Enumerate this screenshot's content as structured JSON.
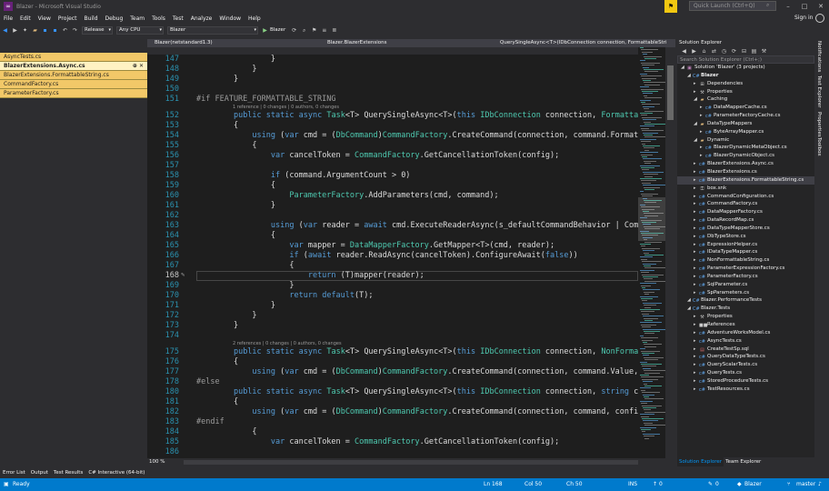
{
  "window": {
    "title": "Blazer - Microsoft Visual Studio",
    "quick_launch_placeholder": "Quick Launch (Ctrl+Q)"
  },
  "menu": [
    "File",
    "Edit",
    "View",
    "Project",
    "Build",
    "Debug",
    "Team",
    "Tools",
    "Test",
    "Analyze",
    "Window",
    "Help"
  ],
  "account": {
    "sign_in": "Sign in"
  },
  "toolbar": {
    "configuration": "Release",
    "platform": "Any CPU",
    "startup_project": "Blazer",
    "run_label": "Blazer"
  },
  "open_documents": [
    {
      "name": "AsyncTests.cs",
      "active": false
    },
    {
      "name": "BlazerExtensions.Async.cs",
      "active": true
    },
    {
      "name": "BlazerExtensions.FormattableString.cs",
      "active": false
    },
    {
      "name": "CommandFactory.cs",
      "active": false
    },
    {
      "name": "ParameterFactory.cs",
      "active": false
    }
  ],
  "editor": {
    "project_tab": "Blazer(netstandard1.3)",
    "nav_class": "Blazer.BlazerExtensions",
    "nav_member": "QuerySingleAsync<T>(IDbConnection connection, FormattableStri",
    "zoom": "100 %",
    "lines": [
      {
        "n": "147",
        "text": "                }"
      },
      {
        "n": "148",
        "text": "            }"
      },
      {
        "n": "149",
        "text": "        }"
      },
      {
        "n": "150",
        "text": ""
      },
      {
        "n": "151",
        "text": "#if FEATURE_FORMATTABLE_STRING"
      },
      {
        "n": "152",
        "text": "        public static async Task<T> QuerySingleAsync<T>(this IDbConnection connection, Formattabl",
        "lens": "1 reference | 0 changes | 0 authors, 0 changes"
      },
      {
        "n": "153",
        "text": "        {"
      },
      {
        "n": "154",
        "text": "            using (var cmd = (DbCommand)CommandFactory.CreateCommand(connection, command.Format, "
      },
      {
        "n": "155",
        "text": "            {"
      },
      {
        "n": "156",
        "text": "                var cancelToken = CommandFactory.GetCancellationToken(config);"
      },
      {
        "n": "157",
        "text": ""
      },
      {
        "n": "158",
        "text": "                if (command.ArgumentCount > 0)"
      },
      {
        "n": "159",
        "text": "                {"
      },
      {
        "n": "160",
        "text": "                    ParameterFactory.AddParameters(cmd, command);"
      },
      {
        "n": "161",
        "text": "                }"
      },
      {
        "n": "162",
        "text": ""
      },
      {
        "n": "163",
        "text": "                using (var reader = await cmd.ExecuteReaderAsync(s_defaultCommandBehavior | Comman"
      },
      {
        "n": "164",
        "text": "                {"
      },
      {
        "n": "165",
        "text": "                    var mapper = DataMapperFactory.GetMapper<T>(cmd, reader);"
      },
      {
        "n": "166",
        "text": "                    if (await reader.ReadAsync(cancelToken).ConfigureAwait(false))"
      },
      {
        "n": "167",
        "text": "                    {"
      },
      {
        "n": "168",
        "text": "                        return (T)mapper(reader);",
        "current": true
      },
      {
        "n": "169",
        "text": "                    }"
      },
      {
        "n": "170",
        "text": "                    return default(T);"
      },
      {
        "n": "171",
        "text": "                }"
      },
      {
        "n": "172",
        "text": "            }"
      },
      {
        "n": "173",
        "text": "        }"
      },
      {
        "n": "174",
        "text": ""
      },
      {
        "n": "175",
        "text": "        public static async Task<T> QuerySingleAsync<T>(this IDbConnection connection, NonFormatt",
        "lens": "2 references | 0 changes | 0 authors, 0 changes"
      },
      {
        "n": "176",
        "text": "        {"
      },
      {
        "n": "177",
        "text": "            using (var cmd = (DbCommand)CommandFactory.CreateCommand(connection, command.Value, c"
      },
      {
        "n": "178",
        "text": "#else"
      },
      {
        "n": "180",
        "text": "        public static async Task<T> QuerySingleAsync<T>(this IDbConnection connection, string com"
      },
      {
        "n": "181",
        "text": "        {"
      },
      {
        "n": "182",
        "text": "            using (var cmd = (DbCommand)CommandFactory.CreateCommand(connection, command, config)"
      },
      {
        "n": "183",
        "text": "#endif"
      },
      {
        "n": "184",
        "text": "            {"
      },
      {
        "n": "185",
        "text": "                var cancelToken = CommandFactory.GetCancellationToken(config);"
      },
      {
        "n": "186",
        "text": ""
      }
    ]
  },
  "solution_explorer": {
    "title": "Solution Explorer",
    "search_placeholder": "Search Solution Explorer (Ctrl+;)",
    "items": [
      {
        "label": "Solution 'Blazer' (3 projects)",
        "level": 0,
        "icon": "solution-icon"
      },
      {
        "label": "Blazer",
        "level": 1,
        "icon": "csharp-project-icon",
        "bold": true
      },
      {
        "label": "Dependencies",
        "level": 2,
        "icon": "dependencies-icon"
      },
      {
        "label": "Properties",
        "level": 2,
        "icon": "wrench-icon"
      },
      {
        "label": "Caching",
        "level": 2,
        "icon": "folder-icon"
      },
      {
        "label": "DataMapperCache.cs",
        "level": 3,
        "icon": "csharp-file-icon"
      },
      {
        "label": "ParameterFactoryCache.cs",
        "level": 3,
        "icon": "csharp-file-icon"
      },
      {
        "label": "DataTypeMappers",
        "level": 2,
        "icon": "folder-icon"
      },
      {
        "label": "ByteArrayMapper.cs",
        "level": 3,
        "icon": "csharp-file-icon"
      },
      {
        "label": "Dynamic",
        "level": 2,
        "icon": "folder-icon"
      },
      {
        "label": "BlazerDynamicMetaObject.cs",
        "level": 3,
        "icon": "csharp-file-icon"
      },
      {
        "label": "BlazerDynamicObject.cs",
        "level": 3,
        "icon": "csharp-file-icon"
      },
      {
        "label": "BlazerExtensions.Async.cs",
        "level": 2,
        "icon": "csharp-file-icon"
      },
      {
        "label": "BlazerExtensions.cs",
        "level": 2,
        "icon": "csharp-file-icon"
      },
      {
        "label": "BlazerExtensions.FormattableString.cs",
        "level": 2,
        "icon": "csharp-file-icon",
        "selected": true
      },
      {
        "label": "box.snk",
        "level": 2,
        "icon": "key-file-icon"
      },
      {
        "label": "CommandConfiguration.cs",
        "level": 2,
        "icon": "csharp-file-icon"
      },
      {
        "label": "CommandFactory.cs",
        "level": 2,
        "icon": "csharp-file-icon"
      },
      {
        "label": "DataMapperFactory.cs",
        "level": 2,
        "icon": "csharp-file-icon"
      },
      {
        "label": "DataRecordMap.cs",
        "level": 2,
        "icon": "csharp-file-icon"
      },
      {
        "label": "DataTypeMapperStore.cs",
        "level": 2,
        "icon": "csharp-file-icon"
      },
      {
        "label": "DbTypeStore.cs",
        "level": 2,
        "icon": "csharp-file-icon"
      },
      {
        "label": "ExpressionHelper.cs",
        "level": 2,
        "icon": "csharp-file-icon"
      },
      {
        "label": "IDataTypeMapper.cs",
        "level": 2,
        "icon": "csharp-file-icon"
      },
      {
        "label": "NonFormattableString.cs",
        "level": 2,
        "icon": "csharp-file-icon"
      },
      {
        "label": "ParameterExpressionFactory.cs",
        "level": 2,
        "icon": "csharp-file-icon"
      },
      {
        "label": "ParameterFactory.cs",
        "level": 2,
        "icon": "csharp-file-icon"
      },
      {
        "label": "SqlParameter.cs",
        "level": 2,
        "icon": "csharp-file-icon"
      },
      {
        "label": "SpParameters.cs",
        "level": 2,
        "icon": "csharp-file-icon"
      },
      {
        "label": "Blazer.PerformanceTests",
        "level": 1,
        "icon": "csharp-project-icon"
      },
      {
        "label": "Blazer.Tests",
        "level": 1,
        "icon": "csharp-project-icon"
      },
      {
        "label": "Properties",
        "level": 2,
        "icon": "wrench-icon"
      },
      {
        "label": "References",
        "level": 2,
        "icon": "references-icon"
      },
      {
        "label": "AdventureWorksModel.cs",
        "level": 2,
        "icon": "csharp-file-icon"
      },
      {
        "label": "AsyncTests.cs",
        "level": 2,
        "icon": "csharp-file-icon"
      },
      {
        "label": "CreateTestSp.sql",
        "level": 2,
        "icon": "sql-file-icon"
      },
      {
        "label": "QueryDataTypeTests.cs",
        "level": 2,
        "icon": "csharp-file-icon"
      },
      {
        "label": "QueryScalarTests.cs",
        "level": 2,
        "icon": "csharp-file-icon"
      },
      {
        "label": "QueryTests.cs",
        "level": 2,
        "icon": "csharp-file-icon"
      },
      {
        "label": "StoredProcedureTests.cs",
        "level": 2,
        "icon": "csharp-file-icon"
      },
      {
        "label": "TestResources.cs",
        "level": 2,
        "icon": "csharp-file-icon"
      }
    ],
    "tabs": [
      "Solution Explorer",
      "Team Explorer"
    ]
  },
  "side_tabs": [
    "Notifications",
    "Test Explorer",
    "Properties",
    "Toolbox"
  ],
  "bottom_tabs": [
    "Error List",
    "Output",
    "Test Results",
    "C# Interactive (64-bit)"
  ],
  "status": {
    "state": "Ready",
    "line": "Ln 168",
    "col": "Col 50",
    "ch": "Ch 50",
    "mode": "INS",
    "up": "0",
    "pending": "0",
    "repo": "Blazer",
    "branch": "master"
  },
  "colors": {
    "accent": "#007acc",
    "tab_yellow": "#f2c868",
    "selection": "#3f3f46"
  }
}
